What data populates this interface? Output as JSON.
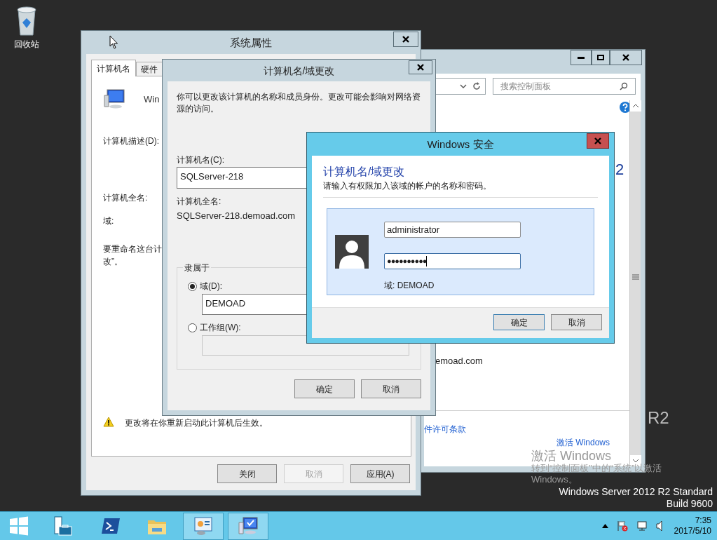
{
  "desktop": {
    "icons": [
      {
        "label": "回收站"
      }
    ],
    "branding": {
      "logo_fragment": "R2",
      "edition": "Windows Server 2012 R2 Standard",
      "build": "Build 9600"
    },
    "activation_watermark": {
      "title": "激活 Windows",
      "message": "转到“控制面板”中的“系统”以激活 Windows。"
    }
  },
  "control_panel_window": {
    "search": {
      "placeholder": "搜索控制面板"
    },
    "heading_fragment": "2",
    "domain_fragment": "emoad.com",
    "license_link": "件许可条款",
    "activate_link": "激活 Windows"
  },
  "system_properties": {
    "title": "系统属性",
    "tabs": [
      {
        "label": "计算机名",
        "selected": true
      },
      {
        "label": "硬件",
        "selected": false
      }
    ],
    "os_text": "Win",
    "labels": [
      "计算机描述(D):",
      "计算机全名:",
      "域:"
    ],
    "rename_hint": [
      "要重命名这台计",
      "改”。"
    ],
    "notice": "更改将在你重新启动此计算机后生效。",
    "buttons": [
      {
        "label": "关闭",
        "disabled": false
      },
      {
        "label": "取消",
        "disabled": true
      },
      {
        "label": "应用(A)",
        "disabled": false
      }
    ]
  },
  "name_change_dialog": {
    "title": "计算机名/域更改",
    "description": "你可以更改该计算机的名称和成员身份。更改可能会影响对网络资源的访问。",
    "computer_name": {
      "label": "计算机名(C):",
      "value": "SQLServer-218"
    },
    "full_name": {
      "label": "计算机全名:",
      "value": "SQLServer-218.demoad.com"
    },
    "member_of": {
      "title": "隶属于",
      "options": [
        {
          "label": "域(D):",
          "selected": true,
          "value": "DEMOAD"
        },
        {
          "label": "工作组(W):",
          "selected": false
        }
      ]
    },
    "buttons": [
      "确定",
      "取消"
    ]
  },
  "security_dialog": {
    "title": "Windows 安全",
    "heading": "计算机名/域更改",
    "instruction": "请输入有权限加入该域的帐户的名称和密码。",
    "username": "administrator",
    "password": "●●●●●●●●●●",
    "domain": "域: DEMOAD",
    "buttons": [
      "确定",
      "取消"
    ]
  },
  "taskbar": {
    "apps": [
      {
        "kind": "start",
        "selected": false
      },
      {
        "kind": "server-manager",
        "selected": false
      },
      {
        "kind": "powershell",
        "selected": false
      },
      {
        "kind": "explorer",
        "selected": false
      },
      {
        "kind": "control-panel",
        "selected": true
      },
      {
        "kind": "system",
        "selected": true
      }
    ],
    "clock": {
      "time": "7:35",
      "date": "2017/5/10"
    }
  }
}
